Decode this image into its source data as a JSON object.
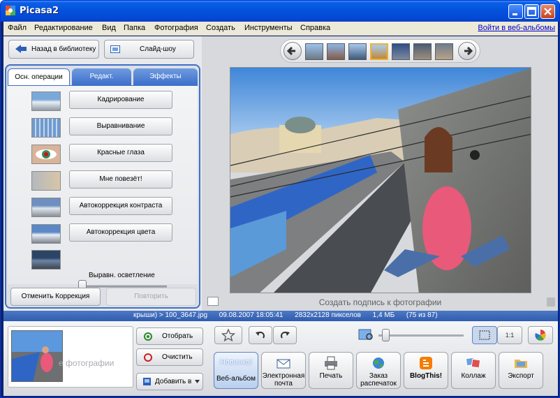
{
  "window": {
    "title": "Picasa2"
  },
  "menu": {
    "items": [
      "Файл",
      "Редактирование",
      "Вид",
      "Папка",
      "Фотография",
      "Создать",
      "Инструменты",
      "Справка"
    ],
    "web_albums_link": "Войти в веб-альбомы"
  },
  "left_panel": {
    "back_button": "Назад в библиотеку",
    "slideshow_button": "Слайд-шоу",
    "tabs": [
      "Осн. операции",
      "Редакт.",
      "Эффекты"
    ],
    "operations": [
      "Кадрирование",
      "Выравнивание",
      "Красные глаза",
      "Мне повезёт!",
      "Автокоррекция контраста",
      "Автокоррекция цвета"
    ],
    "fill_light_label": "Выравн. осветление",
    "fill_light_level": 0.0,
    "undo_button": "Отменить Коррекция",
    "redo_button": "Повторить"
  },
  "viewer": {
    "caption_placeholder": "Создать подпись к фотографии"
  },
  "status": {
    "text": "крыши) > 100_3647.jpg      09.08.2007 18:05:41      2832x2128 пикселов      1,4 МБ      (75 из 87)"
  },
  "tray": {
    "caption": "е фотографии",
    "select_button": "Отобрать",
    "clear_button": "Очистить",
    "add_to_button": "Добавить в",
    "zoom_reset_label": "1:1",
    "actions": [
      {
        "badge": "Новинка!",
        "label": "Веб-альбом"
      },
      {
        "label": "Электронная почта"
      },
      {
        "label": "Печать"
      },
      {
        "label": "Заказ распечаток"
      },
      {
        "label": "BlogThis!"
      },
      {
        "label": "Коллаж"
      },
      {
        "label": "Экспорт"
      }
    ]
  },
  "colors": {
    "titlebar": "#0451dc",
    "status_bar": "#3a66b8",
    "tab_frame": "#3f70c9"
  }
}
